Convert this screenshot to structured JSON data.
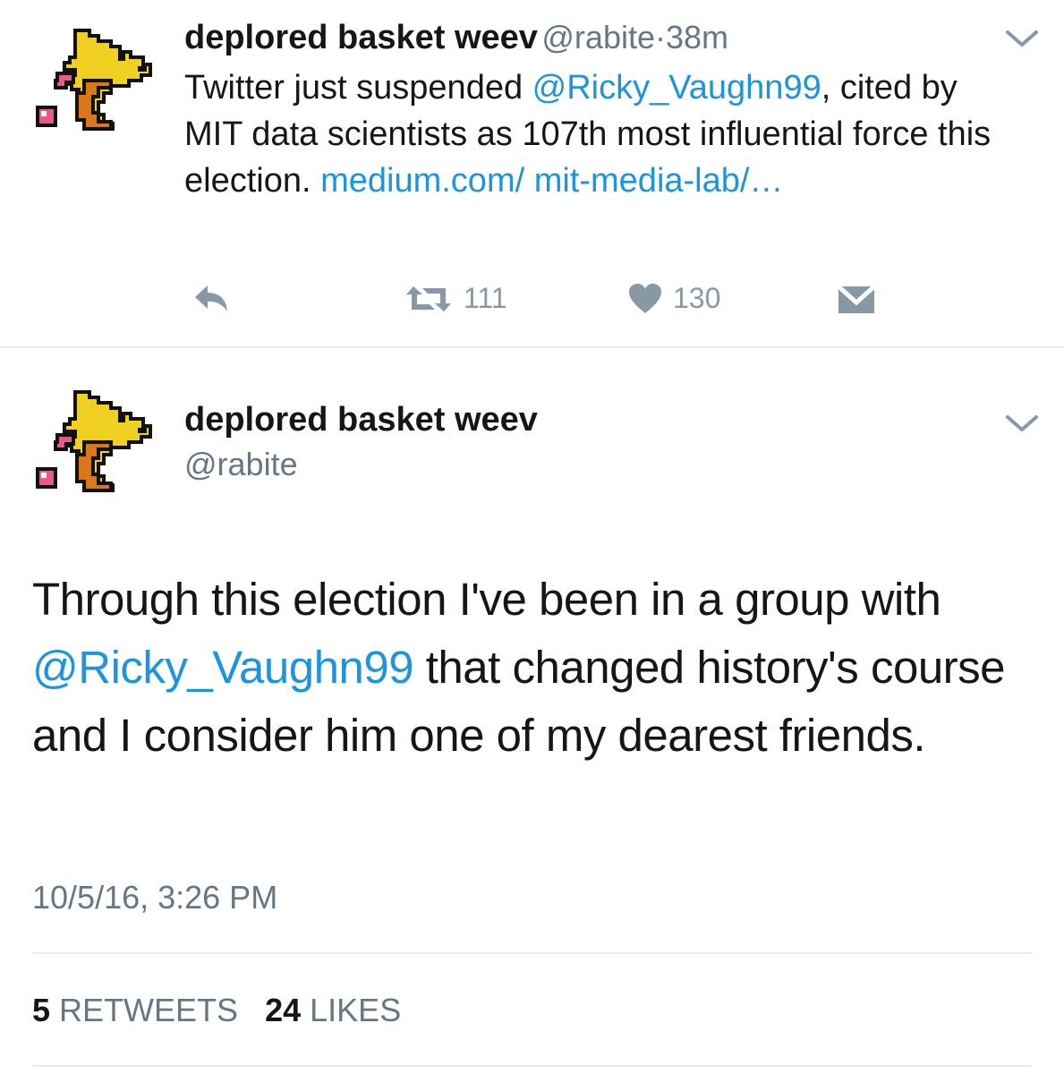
{
  "tweet1": {
    "author_name": "deplored basket weev",
    "author_handle": "@rabite",
    "separator": "·",
    "time_ago": "38m",
    "text_part1": "Twitter just suspended ",
    "mention": "@Ricky_Vaughn99",
    "text_part2": ", cited by MIT data scientists as 107th most influential force this election. ",
    "url": "medium.com/ mit-media-lab/…",
    "retweets": "111",
    "likes": "130"
  },
  "tweet2": {
    "author_name": "deplored basket weev",
    "author_handle": "@rabite",
    "text_part1": "Through this election I've been in a group with ",
    "mention": "@Ricky_Vaughn99",
    "text_part2": " that changed history's course and I consider him one of my dearest friends.",
    "timestamp": "10/5/16, 3:26 PM",
    "retweet_count": "5",
    "retweet_label": "RETWEETS",
    "like_count": "24",
    "like_label": "LIKES"
  },
  "colors": {
    "link": "#1b95e0",
    "muted": "#657786",
    "icon": "#8899a6",
    "avatar_yellow": "#f0d020",
    "avatar_orange": "#d87818",
    "avatar_pink": "#e85888"
  },
  "icons": [
    "rabite-avatar",
    "chevron-down-icon",
    "reply-icon",
    "retweet-icon",
    "heart-icon",
    "direct-message-icon"
  ]
}
